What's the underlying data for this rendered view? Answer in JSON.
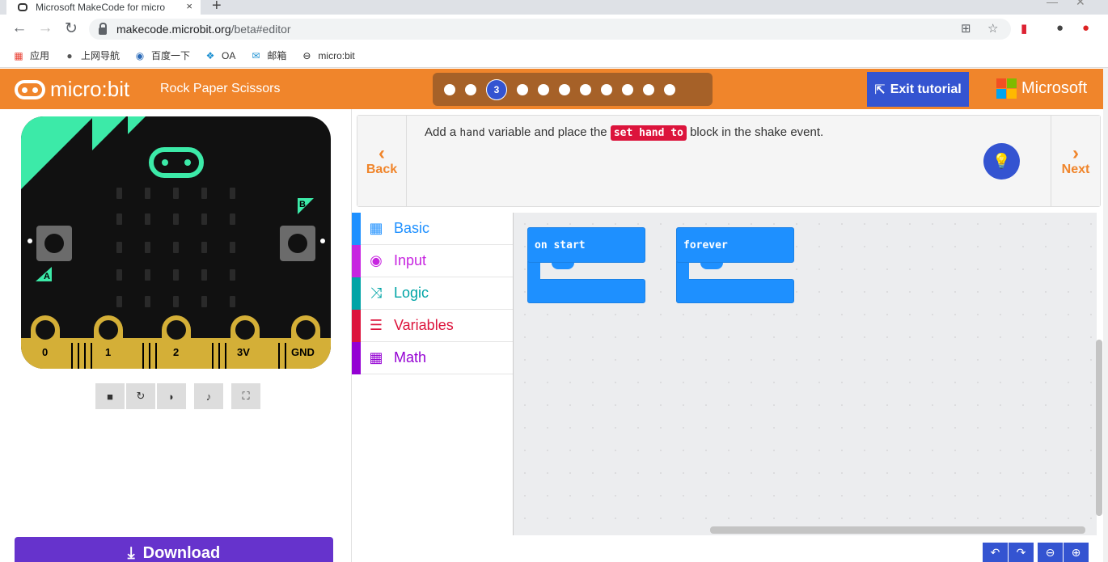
{
  "browser": {
    "tab_title": "Microsoft MakeCode for micro",
    "tab_close": "×",
    "new_tab": "+",
    "url_host": "makecode.microbit.org",
    "url_path": "/beta#editor",
    "bookmarks": [
      "应用",
      "上网导航",
      "百度一下",
      "OA",
      "邮箱",
      "micro:bit"
    ]
  },
  "header": {
    "logo_text": "micro:bit",
    "project_name": "Rock Paper Scissors",
    "current_step": "3",
    "exit_label": "Exit tutorial",
    "brand": "Microsoft"
  },
  "tutorial": {
    "back_label": "Back",
    "next_label": "Next",
    "text_before": "Add a",
    "code_word": "hand",
    "text_middle": "variable and place the",
    "block_name": "set hand to",
    "text_after": "block in the shake event."
  },
  "simulator": {
    "button_a": "A",
    "button_b": "B",
    "pins": [
      "0",
      "1",
      "2",
      "3V",
      "GND"
    ]
  },
  "toolbox": [
    {
      "label": "Basic",
      "color": "#1e90ff",
      "icon": "grid-icon"
    },
    {
      "label": "Input",
      "color": "#c725e0",
      "icon": "target-icon"
    },
    {
      "label": "Logic",
      "color": "#00a4a6",
      "icon": "shuffle-icon"
    },
    {
      "label": "Variables",
      "color": "#dc143c",
      "icon": "list-icon"
    },
    {
      "label": "Math",
      "color": "#9400d3",
      "icon": "calculator-icon"
    }
  ],
  "blocks": {
    "on_start": "on start",
    "forever": "forever"
  },
  "download_label": "Download"
}
